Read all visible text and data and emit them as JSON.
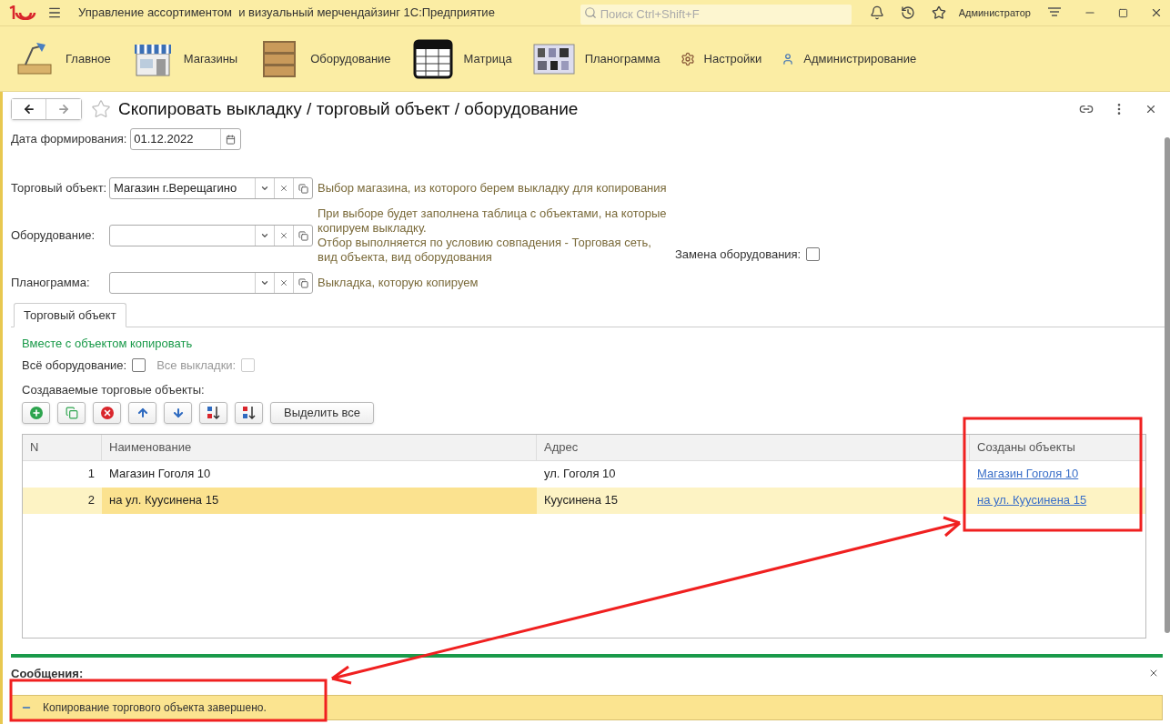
{
  "window": {
    "title": "Управление ассортиментом  и визуальный мерчендайзинг 1С:Предприятие",
    "search_placeholder": "Поиск Ctrl+Shift+F",
    "user": "Администратор"
  },
  "sections": [
    {
      "kind": "desk",
      "label": "Главное"
    },
    {
      "kind": "store",
      "label": "Магазины"
    },
    {
      "kind": "boxes",
      "label": "Оборудование"
    },
    {
      "kind": "grid",
      "label": "Матрица"
    },
    {
      "kind": "planogram",
      "label": "Планограмма"
    },
    {
      "kind": "gear",
      "label": "Настройки"
    },
    {
      "kind": "user",
      "label": "Администрирование"
    }
  ],
  "form": {
    "title": "Скопировать выкладку / торговый объект / оборудование",
    "date": {
      "label": "Дата формирования:",
      "value": "01.12.2022"
    },
    "fields": [
      {
        "label": "Торговый объект:",
        "value": "Магазин г.Верещагино",
        "hint": [
          "Выбор магазина, из которого берем выкладку для копирования"
        ]
      },
      {
        "label": "Оборудование:",
        "hint": [
          "При выборе будет заполнена таблица с объектами, на которые",
          "копируем выкладку.",
          "Отбор выполняется по условию совпадения - Торговая сеть,",
          "вид объекта, вид оборудования"
        ]
      },
      {
        "label": "Планограмма:",
        "hint": [
          "Выкладка, которую копируем"
        ]
      }
    ],
    "replace_equipment": {
      "label": "Замена оборудования:",
      "checked": false
    }
  },
  "tabs": [
    {
      "label": "Торговый объект",
      "selected": true
    }
  ],
  "copy": {
    "heading": "Вместе с объектом копировать",
    "options": [
      {
        "label": "Всё оборудование:",
        "checked": false,
        "disabled": false
      },
      {
        "label": "Все выкладки:",
        "checked": false,
        "disabled": true
      }
    ],
    "list_label": "Создаваемые торговые объекты:",
    "toolbar": [
      {
        "kind": "add"
      },
      {
        "kind": "copy"
      },
      {
        "kind": "delete"
      },
      {
        "kind": "up"
      },
      {
        "kind": "down"
      },
      {
        "kind": "sort-asc"
      },
      {
        "kind": "sort-desc"
      }
    ],
    "select_all": "Выделить все"
  },
  "table": {
    "columns": [
      "N",
      "Наименование",
      "Адрес",
      "Созданы объекты"
    ],
    "rows": [
      {
        "n": "1",
        "name": "Магазин Гоголя 10",
        "address": "ул. Гоголя 10",
        "created": "Магазин Гоголя 10",
        "selected": false
      },
      {
        "n": "2",
        "name": "на ул. Куусинена 15",
        "address": "Куусинена 15",
        "created": "на ул. Куусинена 15",
        "selected": true
      }
    ]
  },
  "messages": {
    "title": "Сообщения:",
    "items": [
      "Копирование торгового объекта завершено."
    ]
  }
}
